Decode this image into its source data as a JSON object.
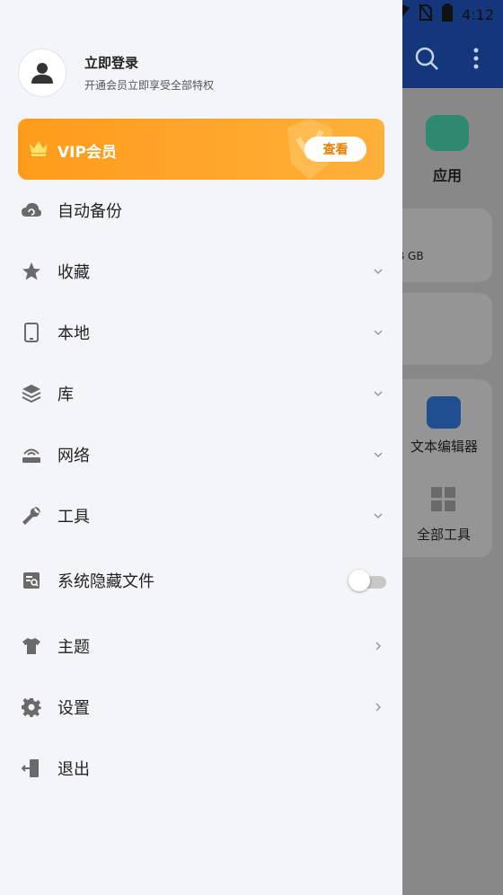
{
  "status_bar": {
    "time": "4:12",
    "icons": [
      "wifi-icon",
      "no-sim-icon",
      "battery-icon"
    ]
  },
  "background": {
    "app_label": "应用",
    "storage_fragment": "B GB",
    "tool_text_editor": "文本编辑器",
    "tool_all": "全部工具",
    "header_color": "#14367a"
  },
  "drawer": {
    "profile": {
      "title": "立即登录",
      "subtitle": "开通会员立即享受全部特权"
    },
    "vip": {
      "label": "VIP会员",
      "button": "查看",
      "accent": "#ff9b1a"
    },
    "menu": [
      {
        "label": "自动备份",
        "icon": "cloud-backup-icon",
        "trailing": "none"
      },
      {
        "label": "收藏",
        "icon": "star-icon",
        "trailing": "chevron-down"
      },
      {
        "label": "本地",
        "icon": "phone-icon",
        "trailing": "chevron-down"
      },
      {
        "label": "库",
        "icon": "layers-icon",
        "trailing": "chevron-down"
      },
      {
        "label": "网络",
        "icon": "router-icon",
        "trailing": "chevron-down"
      },
      {
        "label": "工具",
        "icon": "wrench-icon",
        "trailing": "chevron-down"
      },
      {
        "label": "系统隐藏文件",
        "icon": "hidden-file-icon",
        "trailing": "toggle",
        "toggle_on": false
      },
      {
        "label": "主题",
        "icon": "shirt-icon",
        "trailing": "chevron-right"
      },
      {
        "label": "设置",
        "icon": "gear-icon",
        "trailing": "chevron-right"
      },
      {
        "label": "退出",
        "icon": "exit-icon",
        "trailing": "none"
      }
    ]
  }
}
